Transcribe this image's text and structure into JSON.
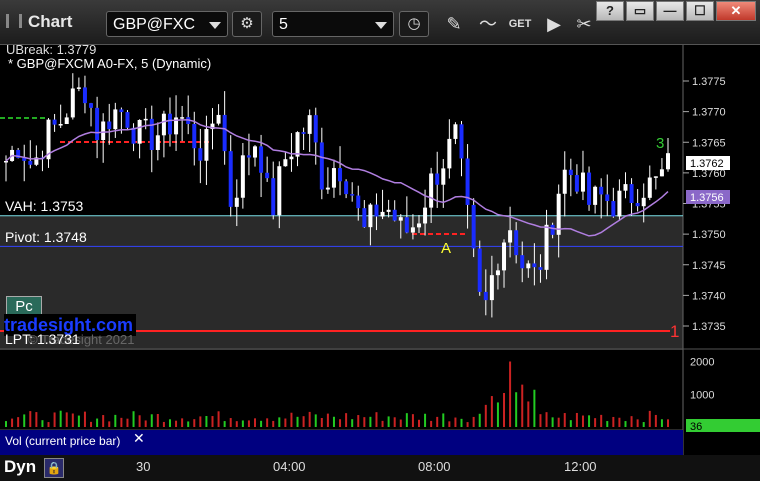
{
  "window": {
    "title": "Chart",
    "symbol": "GBP@FXC",
    "interval": "5",
    "buttons": [
      "clock-icon",
      "pencil-icon",
      "indicator-icon",
      "get-icon",
      "play-icon",
      "tools-icon"
    ],
    "win_controls": [
      "?",
      "▭",
      "—",
      "☐",
      "✕"
    ]
  },
  "chart": {
    "series_title": "* GBP@FXCM A0-FX, 5 (Dynamic)",
    "break_label": "UBreak: 1.3779",
    "vah_label": "VAH: 1.3753",
    "pivot_label": "Pivot: 1.3748",
    "lpt_label": "LPT: 1.3731",
    "watermark": "tradesight.com",
    "copyright": "© Tradesight 2021",
    "pc_badge": "Pc",
    "marker_a": "A",
    "count_right": "3",
    "level_one": "1",
    "last_price": "1.3762",
    "ma_price": "1.3756",
    "vol_label": "Vol (current price bar)",
    "vol_last": "36",
    "footer_dyn": "Dyn"
  },
  "chart_data": {
    "type": "candlestick",
    "price_axis": {
      "ticks": [
        1.3735,
        1.374,
        1.3745,
        1.375,
        1.3755,
        1.376,
        1.3765,
        1.377,
        1.3775
      ],
      "ylim": [
        1.3732,
        1.3781
      ]
    },
    "volume_axis": {
      "ticks": [
        1000,
        2000
      ],
      "ylim": [
        0,
        2200
      ]
    },
    "time_ticks": [
      "30",
      "04:00",
      "08:00",
      "12:00"
    ],
    "levels": {
      "ubreak": 1.3779,
      "vah": 1.3753,
      "pivot": 1.3748,
      "lpt": 1.3734
    },
    "price_path": [
      1.3762,
      1.3765,
      1.3761,
      1.3766,
      1.3768,
      1.3772,
      1.3774,
      1.3766,
      1.377,
      1.377,
      1.3766,
      1.3766,
      1.3767,
      1.377,
      1.3766,
      1.3763,
      1.3772,
      1.3755,
      1.3762,
      1.3766,
      1.3753,
      1.3762,
      1.3766,
      1.3768,
      1.3758,
      1.3762,
      1.3758,
      1.375,
      1.3754,
      1.3754,
      1.375,
      1.3752,
      1.3758,
      1.3762,
      1.3766,
      1.375,
      1.3736,
      1.3746,
      1.3752,
      1.3745,
      1.3743,
      1.375,
      1.376,
      1.376,
      1.3755,
      1.3756,
      1.3755,
      1.3756,
      1.3758,
      1.3758,
      1.3761
    ]
  }
}
